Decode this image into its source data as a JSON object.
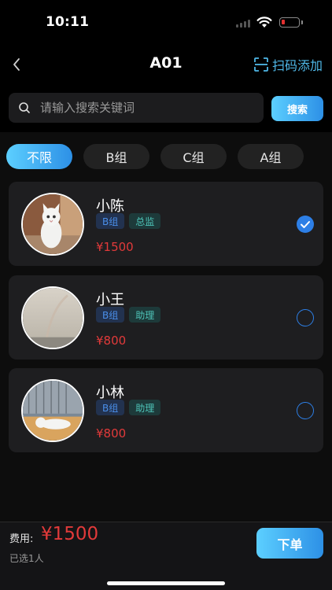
{
  "status_bar": {
    "time": "10:11"
  },
  "nav": {
    "title": "A01",
    "scan_add_label": "扫码添加",
    "back_icon": "chevron-left-icon",
    "scan_icon": "scan-icon"
  },
  "search": {
    "placeholder": "请输入搜索关键词",
    "value": "",
    "button_label": "搜索"
  },
  "filters": [
    {
      "label": "不限",
      "active": true
    },
    {
      "label": "B组",
      "active": false
    },
    {
      "label": "C组",
      "active": false
    },
    {
      "label": "A组",
      "active": false
    }
  ],
  "staff": [
    {
      "name": "小陈",
      "group": "B组",
      "role": "总监",
      "price": "¥1500",
      "selected": true
    },
    {
      "name": "小王",
      "group": "B组",
      "role": "助理",
      "price": "¥800",
      "selected": false
    },
    {
      "name": "小林",
      "group": "B组",
      "role": "助理",
      "price": "¥800",
      "selected": false
    }
  ],
  "footer": {
    "fee_label": "费用:",
    "fee_amount": "¥1500",
    "selected_text": "已选1人",
    "order_button": "下单"
  },
  "colors": {
    "accent": "#2d90e6",
    "price": "#e23a3a",
    "accent_light": "#5ccfff"
  }
}
